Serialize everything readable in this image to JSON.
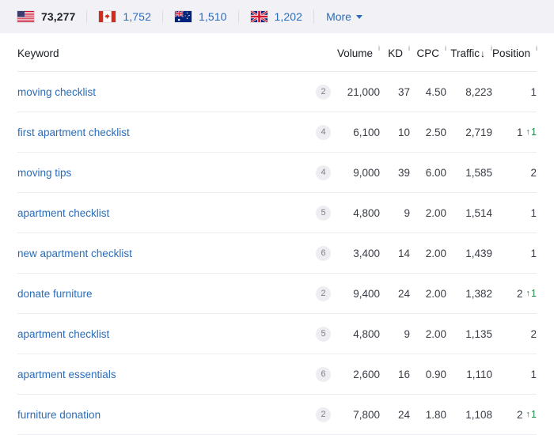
{
  "country_bar": {
    "items": [
      {
        "flag": "us-flag-icon",
        "country": "United States",
        "count": "73,277",
        "active": true
      },
      {
        "flag": "ca-flag-icon",
        "country": "Canada",
        "count": "1,752",
        "active": false
      },
      {
        "flag": "au-flag-icon",
        "country": "Australia",
        "count": "1,510",
        "active": false
      },
      {
        "flag": "gb-flag-icon",
        "country": "United Kingdom",
        "count": "1,202",
        "active": false
      }
    ],
    "more_label": "More",
    "more_caret": "caret-down-icon"
  },
  "table": {
    "columns": {
      "keyword": "Keyword",
      "volume": "Volume",
      "kd": "KD",
      "cpc": "CPC",
      "traffic": "Traffic",
      "position": "Position",
      "info_glyph": "i",
      "sort_glyph": "↓"
    },
    "rows": [
      {
        "keyword": "moving checklist",
        "badge": "2",
        "volume": "21,000",
        "kd": "37",
        "cpc": "4.50",
        "traffic": "8,223",
        "position": "1",
        "delta": "",
        "delta_arrow": ""
      },
      {
        "keyword": "first apartment checklist",
        "badge": "4",
        "volume": "6,100",
        "kd": "10",
        "cpc": "2.50",
        "traffic": "2,719",
        "position": "1",
        "delta": "1",
        "delta_arrow": "↑"
      },
      {
        "keyword": "moving tips",
        "badge": "4",
        "volume": "9,000",
        "kd": "39",
        "cpc": "6.00",
        "traffic": "1,585",
        "position": "2",
        "delta": "",
        "delta_arrow": ""
      },
      {
        "keyword": "apartment checklist",
        "badge": "5",
        "volume": "4,800",
        "kd": "9",
        "cpc": "2.00",
        "traffic": "1,514",
        "position": "1",
        "delta": "",
        "delta_arrow": ""
      },
      {
        "keyword": "new apartment checklist",
        "badge": "6",
        "volume": "3,400",
        "kd": "14",
        "cpc": "2.00",
        "traffic": "1,439",
        "position": "1",
        "delta": "",
        "delta_arrow": ""
      },
      {
        "keyword": "donate furniture",
        "badge": "2",
        "volume": "9,400",
        "kd": "24",
        "cpc": "2.00",
        "traffic": "1,382",
        "position": "2",
        "delta": "1",
        "delta_arrow": "↑"
      },
      {
        "keyword": "apartment checklist",
        "badge": "5",
        "volume": "4,800",
        "kd": "9",
        "cpc": "2.00",
        "traffic": "1,135",
        "position": "2",
        "delta": "",
        "delta_arrow": ""
      },
      {
        "keyword": "apartment essentials",
        "badge": "6",
        "volume": "2,600",
        "kd": "16",
        "cpc": "0.90",
        "traffic": "1,110",
        "position": "1",
        "delta": "",
        "delta_arrow": ""
      },
      {
        "keyword": "furniture donation",
        "badge": "2",
        "volume": "7,800",
        "kd": "24",
        "cpc": "1.80",
        "traffic": "1,108",
        "position": "2",
        "delta": "1",
        "delta_arrow": "↑"
      }
    ]
  },
  "colors": {
    "link": "#2b6cb8",
    "positive": "#1e8a48",
    "bar_bg": "#f2f2f6",
    "badge_bg": "#eeeef2"
  }
}
